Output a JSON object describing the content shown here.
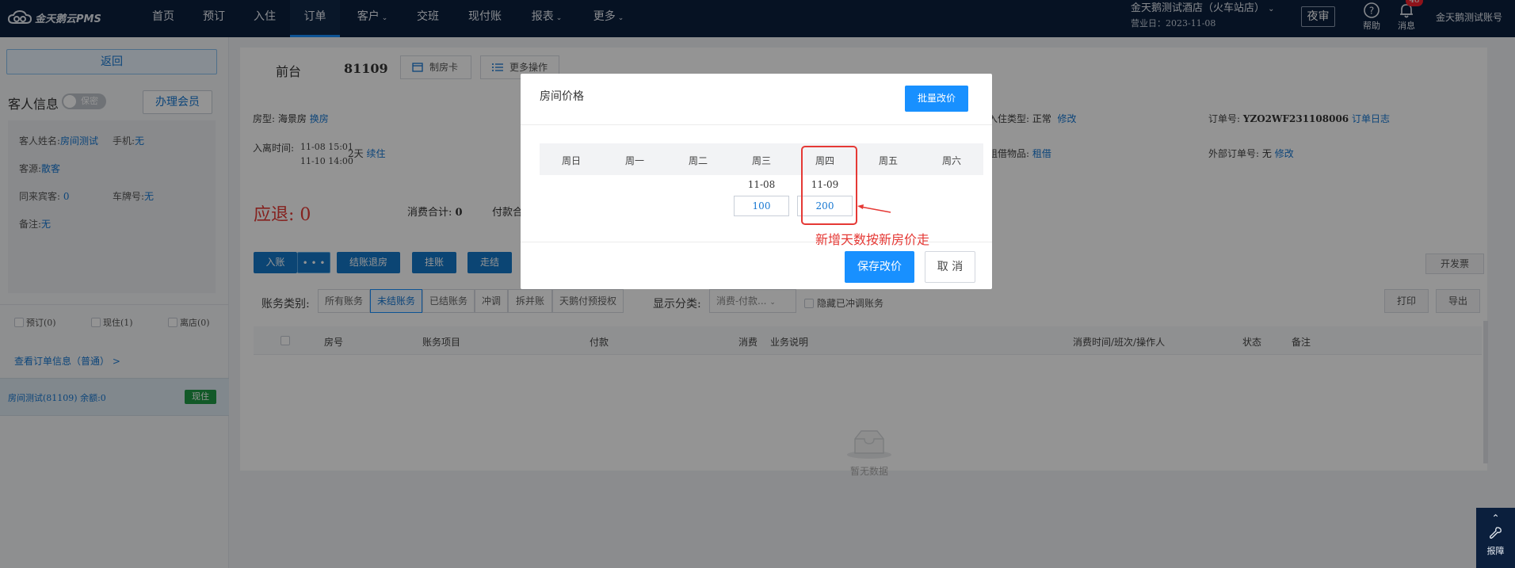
{
  "nav": {
    "logo": "金天鹅云PMS",
    "items": [
      {
        "label": "首页"
      },
      {
        "label": "预订"
      },
      {
        "label": "入住"
      },
      {
        "label": "订单"
      },
      {
        "label": "客户"
      },
      {
        "label": "交班"
      },
      {
        "label": "现付账"
      },
      {
        "label": "报表"
      },
      {
        "label": "更多"
      }
    ],
    "hotel_name": "金天鹅测试酒店（火车站店）",
    "business_date": "营业日：2023-11-08",
    "night_audit": "夜审",
    "help_label": "帮助",
    "messages_label": "消息",
    "badge": "48",
    "account": "金天鹅测试账号"
  },
  "sidebar": {
    "back_label": "返回",
    "guest_info_title": "客人信息",
    "secret_label": "保密",
    "member_btn": "办理会员",
    "guest_name_label": "客人姓名:",
    "guest_name": "房间测试",
    "phone_label": "手机:",
    "phone": "无",
    "source_label": "客源:",
    "source": "散客",
    "companions_label": "同来宾客:",
    "companions": "0",
    "plate_label": "车牌号:",
    "plate": "无",
    "remark_label": "备注:",
    "remark": "无",
    "status_filters": [
      "预订(0)",
      "现住(1)",
      "离店(0)"
    ],
    "order_link": "查看订单信息（普通）  >",
    "room_item": "房间测试(81109)   余额:0",
    "room_status": "现住"
  },
  "main": {
    "front_desk": "前台",
    "room_no": "81109",
    "make_card": "制房卡",
    "more_ops": "更多操作",
    "room_type_label": "房型:",
    "room_type": "海景房",
    "change_room": "换房",
    "checkin_type_label": "入住类型:",
    "checkin_type": "正常",
    "modify": "修改",
    "order_no_label": "订单号:",
    "order_no": "YZO2WF231108006",
    "order_log": "订单日志",
    "stay_label": "入离时间:",
    "stay_in": "11-08 15:01",
    "stay_out": "11-10 14:00",
    "stay_days": "2天",
    "extend": "续住",
    "rental_label": "租借物品:",
    "rental": "租借",
    "ext_order_label": "外部订单号:",
    "ext_order": "无",
    "ext_modify": "修改",
    "refund": "应退:  0",
    "consume_total_label": "消费合计:",
    "consume_total": "0",
    "payment_total_label": "付款合"
  },
  "toolbar": {
    "post": "入账",
    "more_dots": "• • •",
    "checkout": "结账退房",
    "hang": "挂账",
    "walk": "走结",
    "open_invoice": "开发票",
    "print": "打印",
    "export": "导出"
  },
  "filters": {
    "category_label": "账务类别:",
    "buttons": [
      "所有账务",
      "未结账务",
      "已结账务",
      "冲调",
      "拆并账",
      "天鹅付预授权"
    ],
    "display_label": "显示分类:",
    "display_value": "消费-付款...",
    "hide_label": "隐藏已冲调账务"
  },
  "table": {
    "columns": [
      "房号",
      "账务项目",
      "付款",
      "消费",
      "业务说明",
      "消费时间/班次/操作人",
      "状态",
      "备注"
    ],
    "empty_text": "暂无数据"
  },
  "modal": {
    "title": "房间价格",
    "batch_btn": "批量改价",
    "weekdays": [
      "周日",
      "周一",
      "周二",
      "周三",
      "周四",
      "周五",
      "周六"
    ],
    "dates": [
      {
        "weekday": "周三",
        "date": "11-08",
        "price": "100"
      },
      {
        "weekday": "周四",
        "date": "11-09",
        "price": "200"
      }
    ],
    "save_btn": "保存改价",
    "cancel_btn": "取 消"
  },
  "annotation": {
    "text": "新增天数按新房价走",
    "color": "#e53935"
  },
  "report_widget": {
    "label": "报障"
  },
  "colors": {
    "nav_bg": "#0b1f3d",
    "primary": "#1890ff",
    "link": "#1677d2",
    "danger": "#e53935",
    "success": "#1f9a45"
  }
}
